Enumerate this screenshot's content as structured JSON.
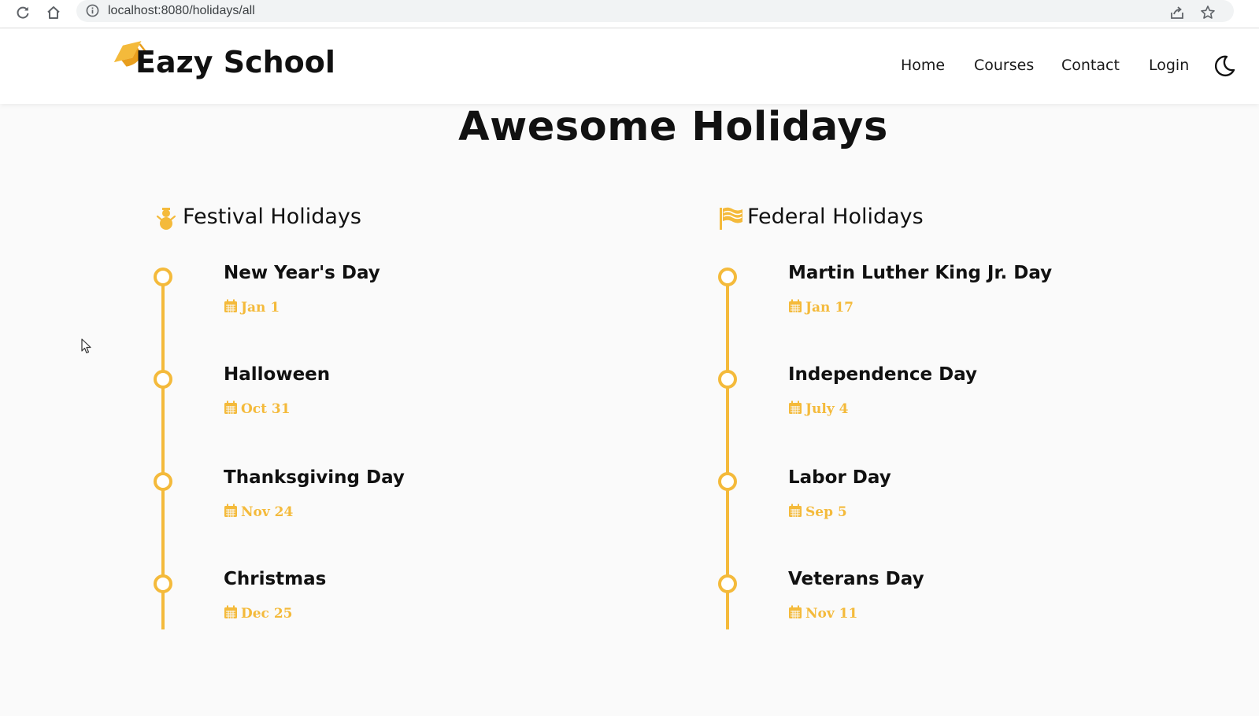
{
  "browser": {
    "url": "localhost:8080/holidays/all",
    "icons": [
      "reload-icon",
      "home-icon",
      "info-icon",
      "share-icon",
      "star-icon"
    ]
  },
  "header": {
    "brand": "Eazy School",
    "logo_icon": "graduation-cap-icon",
    "nav": [
      {
        "label": "Home"
      },
      {
        "label": "Courses"
      },
      {
        "label": "Contact"
      },
      {
        "label": "Login"
      }
    ],
    "theme_icon": "moon-icon"
  },
  "main": {
    "title": "Awesome Holidays",
    "festival": {
      "heading": "Festival Holidays",
      "icon": "snowman-icon",
      "items": [
        {
          "name": "New Year's Day",
          "date": "Jan 1"
        },
        {
          "name": "Halloween",
          "date": "Oct 31"
        },
        {
          "name": "Thanksgiving Day",
          "date": "Nov 24"
        },
        {
          "name": "Christmas",
          "date": "Dec 25"
        }
      ]
    },
    "federal": {
      "heading": "Federal Holidays",
      "icon": "flag-icon",
      "items": [
        {
          "name": "Martin Luther King Jr. Day",
          "date": "Jan 17"
        },
        {
          "name": "Independence Day",
          "date": "July 4"
        },
        {
          "name": "Labor Day",
          "date": "Sep 5"
        },
        {
          "name": "Veterans Day",
          "date": "Nov 11"
        }
      ]
    }
  },
  "colors": {
    "accent": "#f4ba3b",
    "text": "#111111",
    "background": "#fafafa"
  }
}
